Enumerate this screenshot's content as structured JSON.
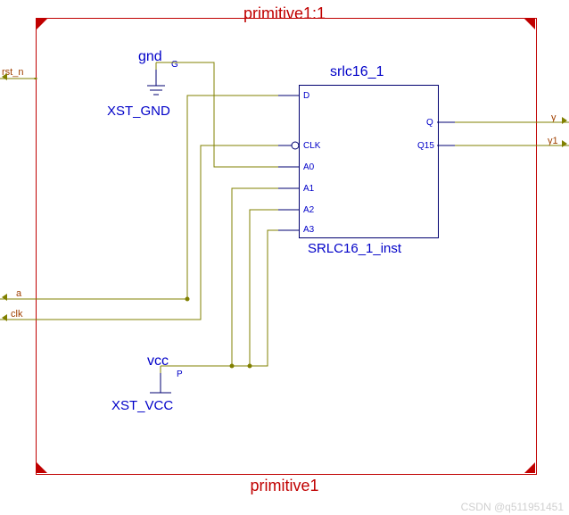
{
  "diagram": {
    "title_top": "primitive1:1",
    "title_bottom": "primitive1",
    "watermark": "CSDN @q511951451"
  },
  "gnd": {
    "inst_name": "gnd",
    "pin": "G",
    "ref_name": "XST_GND"
  },
  "vcc": {
    "inst_name": "vcc",
    "pin": "P",
    "ref_name": "XST_VCC"
  },
  "srl": {
    "inst_name": "srlc16_1",
    "ref_name": "SRLC16_1_inst",
    "pins_left": [
      "D",
      "CLK",
      "A0",
      "A1",
      "A2",
      "A3"
    ],
    "pins_right": [
      "Q",
      "Q15"
    ]
  },
  "ports": {
    "rst_n": "rst_n",
    "a": "a",
    "clk": "clk",
    "y": "y",
    "y1": "y1"
  }
}
